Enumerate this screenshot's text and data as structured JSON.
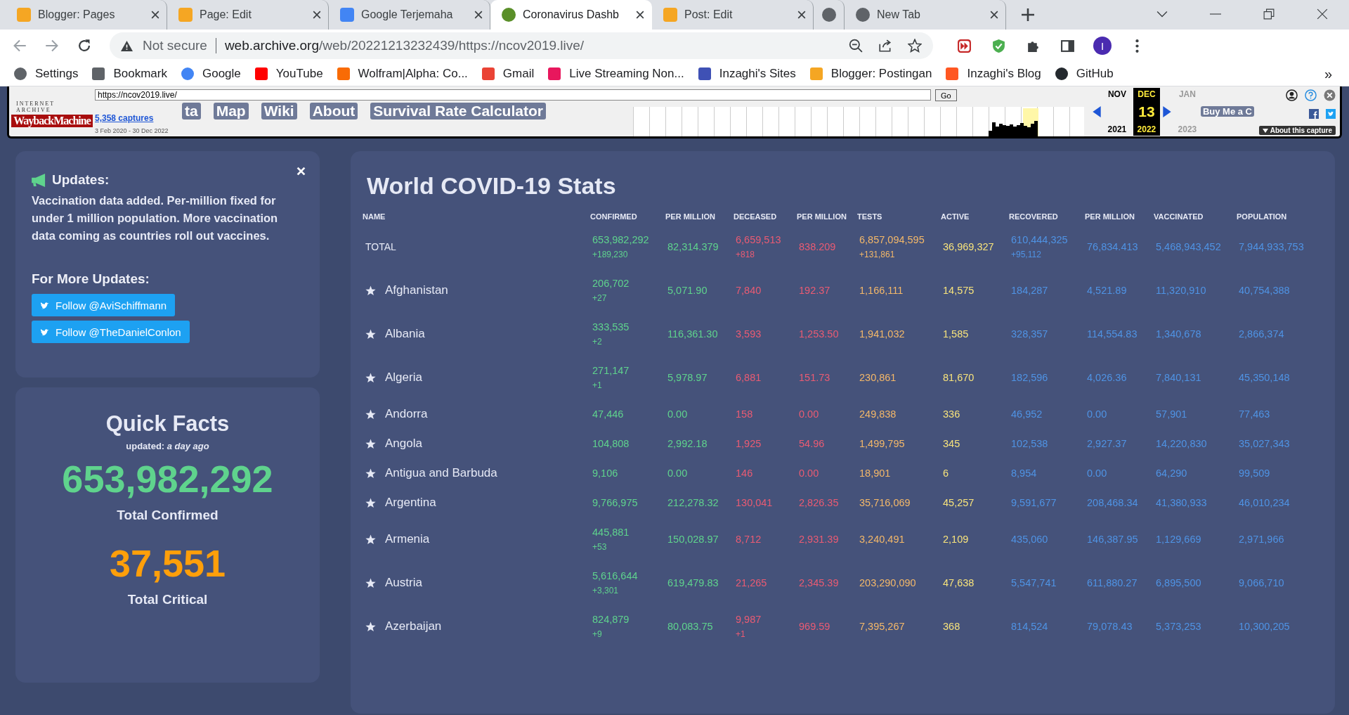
{
  "browser": {
    "tabs": [
      {
        "title": "Blogger: Pages",
        "selected": false
      },
      {
        "title": "Page: Edit",
        "selected": false
      },
      {
        "title": "Google Terjemaha",
        "selected": false
      },
      {
        "title": "Coronavirus Dashb",
        "selected": true
      },
      {
        "title": "Post: Edit",
        "selected": false
      },
      {
        "selected": false
      },
      {
        "title": "New Tab",
        "selected": false
      }
    ],
    "security": "Not secure",
    "url_host": "web.archive.org",
    "url_path": "/web/20221213232439/https://ncov2019.live/",
    "profile": "I",
    "bookmarks": [
      {
        "label": "Settings"
      },
      {
        "label": "Bookmark"
      },
      {
        "label": "Google"
      },
      {
        "label": "YouTube"
      },
      {
        "label": "Wolfram|Alpha: Co..."
      },
      {
        "label": "Gmail"
      },
      {
        "label": "Live Streaming Non..."
      },
      {
        "label": "Inzaghi's Sites"
      },
      {
        "label": "Blogger: Postingan"
      },
      {
        "label": "Inzaghi's Blog"
      },
      {
        "label": "GitHub"
      }
    ],
    "overflow": "»"
  },
  "wayback": {
    "brand": "INTERNET ARCHIVE",
    "logo": "WaybackMachine",
    "url": "https://ncov2019.live/",
    "go": "Go",
    "captures": "5,358 captures",
    "range": "3 Feb 2020 - 30 Dec 2022",
    "months": [
      {
        "month": "NOV",
        "year": "2021",
        "selected": false
      },
      {
        "month": "DEC",
        "day": "13",
        "year": "2022",
        "selected": true
      },
      {
        "month": "JAN",
        "year": "2023",
        "selected": false
      }
    ],
    "about": "About this capture"
  },
  "site_nav": {
    "items": [
      "ta",
      "Map",
      "Wiki",
      "About",
      "Survival Rate Calculator"
    ],
    "donate": "Buy Me a C"
  },
  "updates": {
    "title": "Updates:",
    "text": "Vaccination data added. Per-million fixed for under 1 million population. More vaccination data coming as countries roll out vaccines.",
    "more_title": "For More Updates:",
    "buttons": [
      "Follow @AviSchiffmann",
      "Follow @TheDanielConlon"
    ]
  },
  "quick_facts": {
    "title": "Quick Facts",
    "updated": "updated: *a day ago*",
    "stats": [
      {
        "value": "653,982,292",
        "label": "Total Confirmed",
        "kind": "confirmed"
      },
      {
        "value": "37,551",
        "label": "Total Critical",
        "kind": "critical"
      }
    ]
  },
  "table": {
    "title": "World COVID-19 Stats",
    "columns": [
      {
        "label": "NAME",
        "kind": "name"
      },
      {
        "label": "CONFIRMED",
        "kind": "confirmed"
      },
      {
        "label": "PER MILLION",
        "kind": "confirmed"
      },
      {
        "label": "DECEASED",
        "kind": "deceased"
      },
      {
        "label": "PER MILLION",
        "kind": "deceased"
      },
      {
        "label": "TESTS",
        "kind": "tests"
      },
      {
        "label": "ACTIVE",
        "kind": "active"
      },
      {
        "label": "RECOVERED",
        "kind": "recovered"
      },
      {
        "label": "PER MILLION",
        "kind": "recovered"
      },
      {
        "label": "VACCINATED",
        "kind": "recovered"
      },
      {
        "label": "POPULATION",
        "kind": "recovered"
      }
    ],
    "rows": [
      {
        "kind": "total",
        "cells": [
          {
            "value": "TOTAL"
          },
          {
            "value": "653,982,292",
            "delta": "+189,230"
          },
          {
            "value": "82,314.379"
          },
          {
            "value": "6,659,513",
            "delta": "+818"
          },
          {
            "value": "838.209"
          },
          {
            "value": "6,857,094,595",
            "delta": "+131,861"
          },
          {
            "value": "36,969,327"
          },
          {
            "value": "610,444,325",
            "delta": "+95,112"
          },
          {
            "value": "76,834.413"
          },
          {
            "value": "5,468,943,452"
          },
          {
            "value": "7,944,933,753"
          }
        ]
      },
      {
        "kind": "country",
        "cells": [
          {
            "value": "Afghanistan"
          },
          {
            "value": "206,702",
            "delta": "+27"
          },
          {
            "value": "5,071.90"
          },
          {
            "value": "7,840"
          },
          {
            "value": "192.37"
          },
          {
            "value": "1,166,111"
          },
          {
            "value": "14,575"
          },
          {
            "value": "184,287"
          },
          {
            "value": "4,521.89"
          },
          {
            "value": "11,320,910"
          },
          {
            "value": "40,754,388"
          }
        ]
      },
      {
        "kind": "country",
        "cells": [
          {
            "value": "Albania"
          },
          {
            "value": "333,535",
            "delta": "+2"
          },
          {
            "value": "116,361.30"
          },
          {
            "value": "3,593"
          },
          {
            "value": "1,253.50"
          },
          {
            "value": "1,941,032"
          },
          {
            "value": "1,585"
          },
          {
            "value": "328,357"
          },
          {
            "value": "114,554.83"
          },
          {
            "value": "1,340,678"
          },
          {
            "value": "2,866,374"
          }
        ]
      },
      {
        "kind": "country",
        "cells": [
          {
            "value": "Algeria"
          },
          {
            "value": "271,147",
            "delta": "+1"
          },
          {
            "value": "5,978.97"
          },
          {
            "value": "6,881"
          },
          {
            "value": "151.73"
          },
          {
            "value": "230,861"
          },
          {
            "value": "81,670"
          },
          {
            "value": "182,596"
          },
          {
            "value": "4,026.36"
          },
          {
            "value": "7,840,131"
          },
          {
            "value": "45,350,148"
          }
        ]
      },
      {
        "kind": "country",
        "cells": [
          {
            "value": "Andorra"
          },
          {
            "value": "47,446"
          },
          {
            "value": "0.00"
          },
          {
            "value": "158"
          },
          {
            "value": "0.00"
          },
          {
            "value": "249,838"
          },
          {
            "value": "336"
          },
          {
            "value": "46,952"
          },
          {
            "value": "0.00"
          },
          {
            "value": "57,901"
          },
          {
            "value": "77,463"
          }
        ]
      },
      {
        "kind": "country",
        "cells": [
          {
            "value": "Angola"
          },
          {
            "value": "104,808"
          },
          {
            "value": "2,992.18"
          },
          {
            "value": "1,925"
          },
          {
            "value": "54.96"
          },
          {
            "value": "1,499,795"
          },
          {
            "value": "345"
          },
          {
            "value": "102,538"
          },
          {
            "value": "2,927.37"
          },
          {
            "value": "14,220,830"
          },
          {
            "value": "35,027,343"
          }
        ]
      },
      {
        "kind": "country",
        "cells": [
          {
            "value": "Antigua and Barbuda"
          },
          {
            "value": "9,106"
          },
          {
            "value": "0.00"
          },
          {
            "value": "146"
          },
          {
            "value": "0.00"
          },
          {
            "value": "18,901"
          },
          {
            "value": "6"
          },
          {
            "value": "8,954"
          },
          {
            "value": "0.00"
          },
          {
            "value": "64,290"
          },
          {
            "value": "99,509"
          }
        ]
      },
      {
        "kind": "country",
        "cells": [
          {
            "value": "Argentina"
          },
          {
            "value": "9,766,975"
          },
          {
            "value": "212,278.32"
          },
          {
            "value": "130,041"
          },
          {
            "value": "2,826.35"
          },
          {
            "value": "35,716,069"
          },
          {
            "value": "45,257"
          },
          {
            "value": "9,591,677"
          },
          {
            "value": "208,468.34"
          },
          {
            "value": "41,380,933"
          },
          {
            "value": "46,010,234"
          }
        ]
      },
      {
        "kind": "country",
        "cells": [
          {
            "value": "Armenia"
          },
          {
            "value": "445,881",
            "delta": "+53"
          },
          {
            "value": "150,028.97"
          },
          {
            "value": "8,712"
          },
          {
            "value": "2,931.39"
          },
          {
            "value": "3,240,491"
          },
          {
            "value": "2,109"
          },
          {
            "value": "435,060"
          },
          {
            "value": "146,387.95"
          },
          {
            "value": "1,129,669"
          },
          {
            "value": "2,971,966"
          }
        ]
      },
      {
        "kind": "country",
        "cells": [
          {
            "value": "Austria"
          },
          {
            "value": "5,616,644",
            "delta": "+3,301"
          },
          {
            "value": "619,479.83"
          },
          {
            "value": "21,265"
          },
          {
            "value": "2,345.39"
          },
          {
            "value": "203,290,090"
          },
          {
            "value": "47,638"
          },
          {
            "value": "5,547,741"
          },
          {
            "value": "611,880.27"
          },
          {
            "value": "6,895,500"
          },
          {
            "value": "9,066,710"
          }
        ]
      },
      {
        "kind": "country",
        "cells": [
          {
            "value": "Azerbaijan"
          },
          {
            "value": "824,879",
            "delta": "+9"
          },
          {
            "value": "80,083.75"
          },
          {
            "value": "9,987",
            "delta": "+1"
          },
          {
            "value": "969.59"
          },
          {
            "value": "7,395,267"
          },
          {
            "value": "368"
          },
          {
            "value": "814,524"
          },
          {
            "value": "79,078.43"
          },
          {
            "value": "5,373,253"
          },
          {
            "value": "10,300,205"
          }
        ]
      }
    ]
  }
}
